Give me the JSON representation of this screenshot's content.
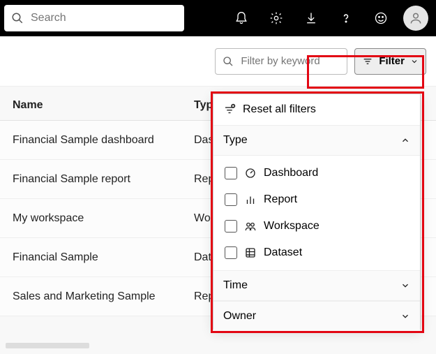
{
  "topbar": {
    "search_placeholder": "Search"
  },
  "toolbar": {
    "keyword_placeholder": "Filter by keyword",
    "filter_label": "Filter"
  },
  "table": {
    "columns": [
      "Name",
      "Type"
    ],
    "rows": [
      {
        "name": "Financial Sample dashboard",
        "type": "Dashboard"
      },
      {
        "name": "Financial Sample report",
        "type": "Report"
      },
      {
        "name": "My workspace",
        "type": "Workspace"
      },
      {
        "name": "Financial Sample",
        "type": "Dataset"
      },
      {
        "name": "Sales and Marketing Sample",
        "type": "Report"
      }
    ]
  },
  "filter_panel": {
    "reset_label": "Reset all filters",
    "sections": [
      {
        "title": "Type",
        "expanded": true,
        "options": [
          "Dashboard",
          "Report",
          "Workspace",
          "Dataset"
        ]
      },
      {
        "title": "Time",
        "expanded": false
      },
      {
        "title": "Owner",
        "expanded": false
      }
    ]
  },
  "annotation": {
    "color": "#e30613",
    "targets": [
      "filter-button",
      "filter-panel"
    ]
  }
}
